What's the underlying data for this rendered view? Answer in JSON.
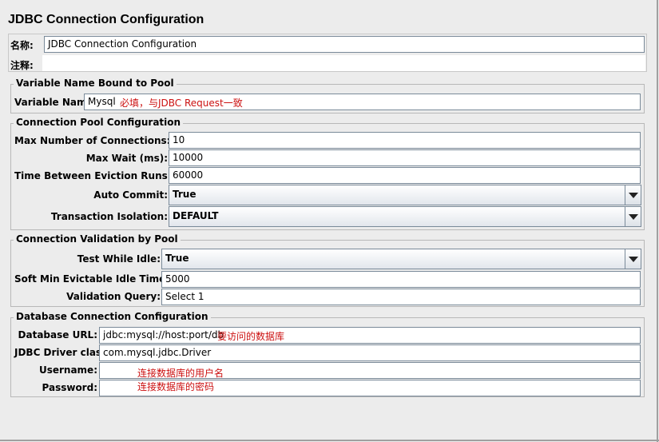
{
  "title": "JDBC Connection Configuration",
  "top": {
    "name_label": "名称:",
    "name_value": "JDBC Connection Configuration",
    "comment_label": "注释:",
    "comment_value": ""
  },
  "pool_binding": {
    "legend": "Variable Name Bound to Pool",
    "variable_name_label": "Variable Name:",
    "variable_name_value": "Mysql",
    "variable_name_note": "必填，与JDBC Request一致"
  },
  "connection_pool": {
    "legend": "Connection Pool Configuration",
    "max_connections_label": "Max Number of Connections:",
    "max_connections_value": "10",
    "max_wait_label": "Max Wait (ms):",
    "max_wait_value": "10000",
    "eviction_label": "Time Between Eviction Runs (ms):",
    "eviction_value": "60000",
    "auto_commit_label": "Auto Commit:",
    "auto_commit_value": "True",
    "isolation_label": "Transaction Isolation:",
    "isolation_value": "DEFAULT"
  },
  "validation": {
    "legend": "Connection Validation by Pool",
    "test_idle_label": "Test While Idle:",
    "test_idle_value": "True",
    "soft_min_label": "Soft Min Evictable Idle Time(ms):",
    "soft_min_value": "5000",
    "query_label": "Validation Query:",
    "query_value": "Select 1"
  },
  "database": {
    "legend": "Database Connection Configuration",
    "url_label": "Database URL:",
    "url_value": "jdbc:mysql://host:port/db",
    "url_note": "要访问的数据库",
    "driver_label": "JDBC Driver class:",
    "driver_value": "com.mysql.jdbc.Driver",
    "username_label": "Username:",
    "username_value": "",
    "username_note": "连接数据库的用户名",
    "password_label": "Password:",
    "password_value": "",
    "password_note": "连接数据库的密码"
  },
  "icons": {
    "dropdown": "chevron-down-icon"
  },
  "colors": {
    "note": "#cc1111",
    "background": "#ececec",
    "field_border": "#7a8a99"
  }
}
